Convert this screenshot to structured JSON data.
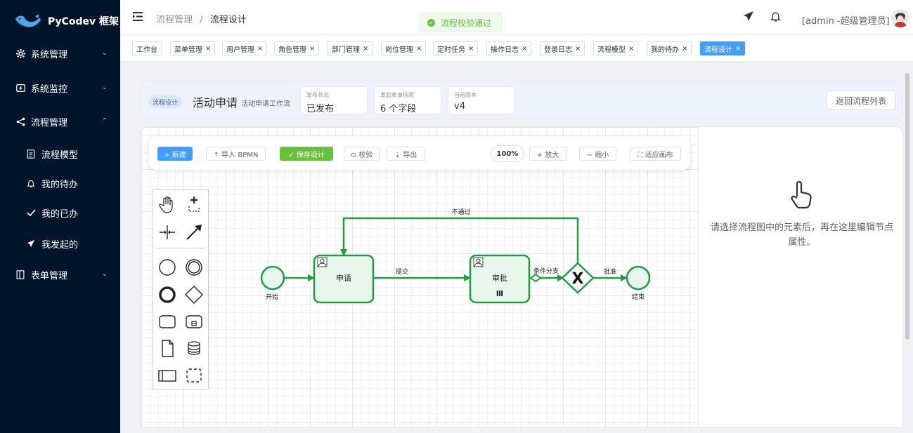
{
  "app": {
    "name": "PyCodev 框架"
  },
  "sidebar": {
    "items": [
      {
        "label": "系统管理",
        "icon": "gear-icon"
      },
      {
        "label": "系统监控",
        "icon": "monitor-icon"
      },
      {
        "label": "流程管理",
        "icon": "share-icon"
      },
      {
        "label": "流程模型",
        "icon": "document-icon"
      },
      {
        "label": "我的待办",
        "icon": "bell-icon"
      },
      {
        "label": "我的已办",
        "icon": "check-icon"
      },
      {
        "label": "我发起的",
        "icon": "send-icon"
      },
      {
        "label": "表单管理",
        "icon": "form-icon"
      }
    ]
  },
  "header": {
    "breadcrumb": [
      "流程管理",
      "流程设计"
    ],
    "breadcrumb_sep": "/",
    "toast": "流程校验通过",
    "user": "[admin -超级管理员]"
  },
  "tags": [
    {
      "label": "工作台",
      "closable": false
    },
    {
      "label": "菜单管理",
      "closable": true
    },
    {
      "label": "用户管理",
      "closable": true
    },
    {
      "label": "角色管理",
      "closable": true
    },
    {
      "label": "部门管理",
      "closable": true
    },
    {
      "label": "岗位管理",
      "closable": true
    },
    {
      "label": "定时任务",
      "closable": true
    },
    {
      "label": "操作日志",
      "closable": true
    },
    {
      "label": "登录日志",
      "closable": true
    },
    {
      "label": "流程模型",
      "closable": true
    },
    {
      "label": "我的待办",
      "closable": true
    },
    {
      "label": "流程设计",
      "closable": true,
      "active": true
    }
  ],
  "close_glyph": "×",
  "info": {
    "pill": "流程设计",
    "title": "活动申请",
    "subtitle": "活动申请工作流",
    "meta": [
      {
        "label": "发布状态",
        "value": "已发布"
      },
      {
        "label": "发起表单快照",
        "value": "6 个字段"
      },
      {
        "label": "当前版本",
        "value": "v4"
      }
    ],
    "back_button": "返回流程列表"
  },
  "toolbar": {
    "new": "+ 新建",
    "import": "⇡ 导入 BPMN",
    "save": "✓ 保存设计",
    "validate": "⊙ 校验",
    "export": "⇣ 导出",
    "zoom_level": "100%",
    "zoom_in": "+ 放大",
    "zoom_out": "− 缩小",
    "fit": "⛶ 适应画布"
  },
  "diagram": {
    "nodes": {
      "start": "开始",
      "apply": "申请",
      "approve": "审批",
      "end": "结束"
    },
    "flows": {
      "submit": "提交",
      "branch": "条件分支",
      "approved": "批准",
      "rejected": "不通过"
    },
    "gateway_mark": "X",
    "multi_instance_mark": "Ⅲ"
  },
  "props": {
    "hint": "请选择流程图中的元素后，再在这里编辑节点属性。"
  },
  "colors": {
    "sidebar_bg": "#001529",
    "primary": "#409eff",
    "success": "#67c23a",
    "bpmn_stroke": "#1f9d45",
    "bpmn_fill": "#e8f6ec"
  }
}
